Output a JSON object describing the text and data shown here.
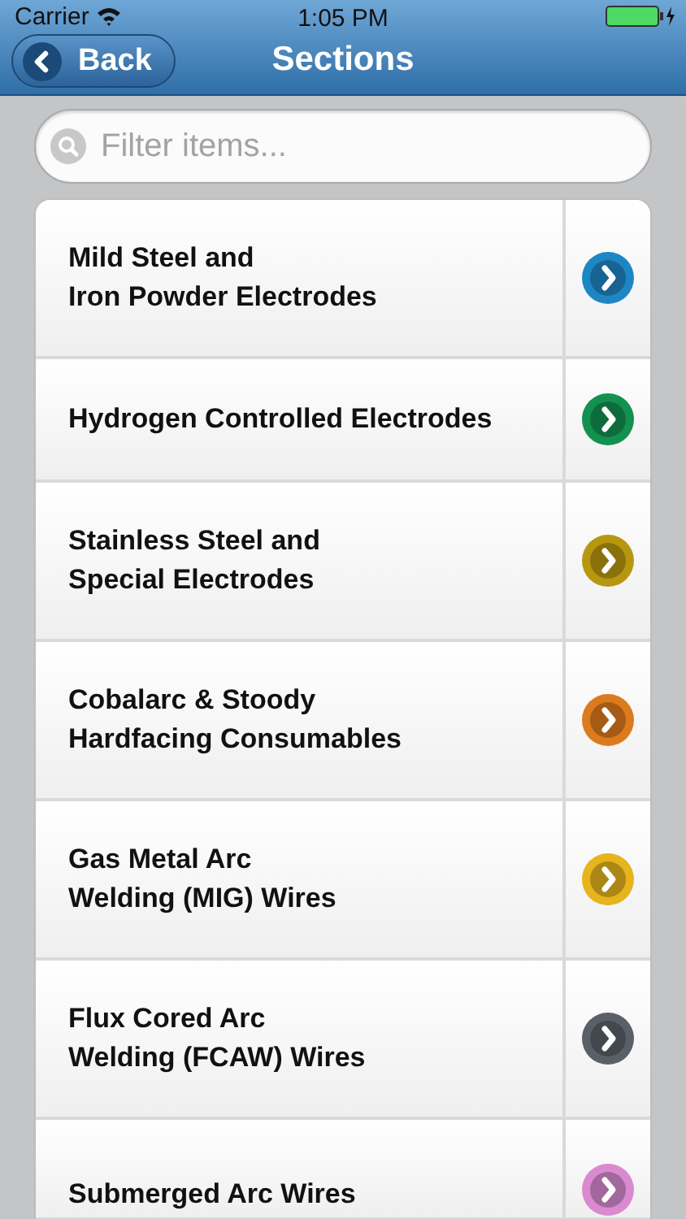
{
  "status_bar": {
    "carrier": "Carrier",
    "time": "1:05 PM"
  },
  "nav": {
    "back": "Back",
    "title": "Sections"
  },
  "search": {
    "placeholder": "Filter items..."
  },
  "sections": [
    {
      "lines": [
        "Mild Steel and",
        "Iron Powder Electrodes"
      ],
      "color": "#1f86c4"
    },
    {
      "lines": [
        "Hydrogen Controlled Electrodes"
      ],
      "color": "#139150"
    },
    {
      "lines": [
        "Stainless Steel and",
        "Special Electrodes"
      ],
      "color": "#b89710"
    },
    {
      "lines": [
        "Cobalarc & Stoody",
        "Hardfacing Consumables"
      ],
      "color": "#dc7a1e"
    },
    {
      "lines": [
        "Gas Metal Arc",
        "Welding (MIG) Wires"
      ],
      "color": "#e6b41c"
    },
    {
      "lines": [
        "Flux Cored Arc",
        "Welding (FCAW) Wires"
      ],
      "color": "#5a6068"
    },
    {
      "lines": [
        "Submerged Arc Wires"
      ],
      "color": "#d98ad0"
    }
  ]
}
